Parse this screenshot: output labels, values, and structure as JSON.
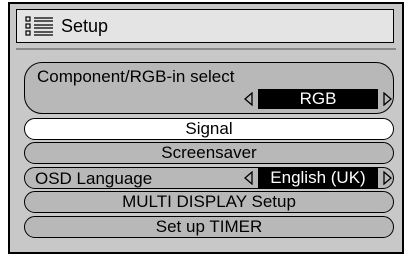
{
  "title": "Setup",
  "menu_icon": "list-menu-icon",
  "items": [
    {
      "label": "Component/RGB-in  select",
      "value": "RGB"
    },
    {
      "label": "Signal"
    },
    {
      "label": "Screensaver"
    },
    {
      "label": "OSD  Language",
      "value": "English (UK)"
    },
    {
      "label": "MULTI DISPLAY Setup"
    },
    {
      "label": "Set up TIMER"
    }
  ],
  "colors": {
    "frame": "#c8c8c8",
    "title_bg": "#e4e4e4",
    "item_bg": "#b8b8b8",
    "selected_bg": "#ffffff",
    "value_bg": "#000000"
  }
}
